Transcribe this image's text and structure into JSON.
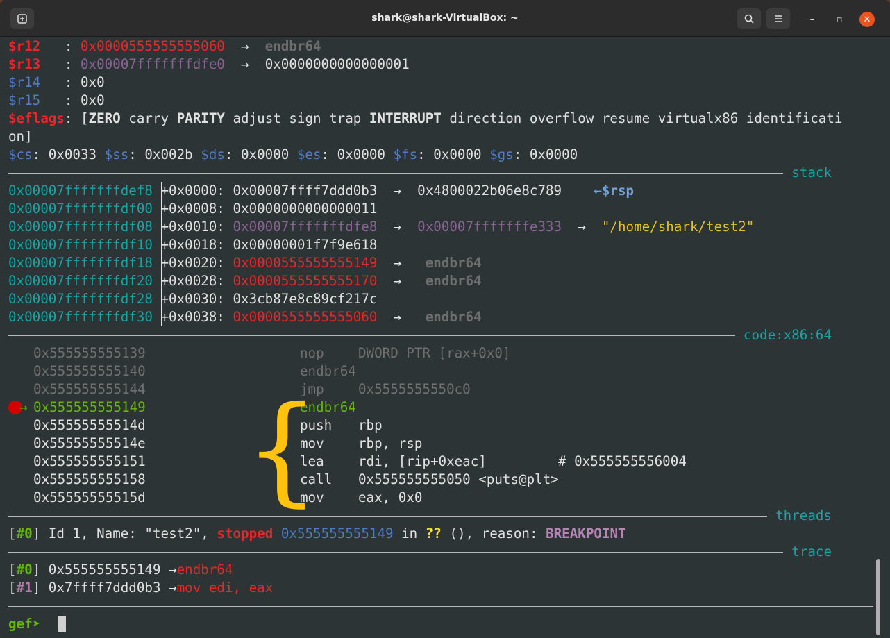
{
  "window": {
    "title": "shark@shark-VirtualBox: ~",
    "newtab_icon": "new-tab-icon",
    "search_icon": "search-icon",
    "menu_icon": "hamburger-menu-icon",
    "minimize_glyph": "–",
    "maximize_glyph": "▫",
    "close_glyph": "✕"
  },
  "registers": [
    {
      "name": "$r12",
      "colon": "   : ",
      "value": "0x0000555555555060",
      "arrow": "  →  ",
      "target": "endbr64"
    },
    {
      "name": "$r13",
      "colon": "   : ",
      "value": "0x00007fffffffdfe0",
      "arrow": "  →  ",
      "target": "0x0000000000000001"
    },
    {
      "name": "$r14",
      "colon": "   : ",
      "value": "0x0"
    },
    {
      "name": "$r15",
      "colon": "   : ",
      "value": "0x0"
    }
  ],
  "eflags": {
    "label": "$eflags",
    "line1_parts": [
      ": [",
      "ZERO",
      " carry ",
      "PARITY",
      " adjust sign trap ",
      "INTERRUPT",
      " direction overflow resume virtualx86 identificati"
    ],
    "line2": "on]"
  },
  "segments": [
    {
      "name": "$cs",
      "value": ": 0x0033 "
    },
    {
      "name": "$ss",
      "value": ": 0x002b "
    },
    {
      "name": "$ds",
      "value": ": 0x0000 "
    },
    {
      "name": "$es",
      "value": ": 0x0000 "
    },
    {
      "name": "$fs",
      "value": ": 0x0000 "
    },
    {
      "name": "$gs",
      "value": ": 0x0000"
    }
  ],
  "sections": {
    "stack": "stack",
    "code": "code:x86:64",
    "threads": "threads",
    "trace": "trace"
  },
  "stack": [
    {
      "addr": "0x00007fffffffdef8",
      "offset": "+0x0000: ",
      "value": "0x00007ffff7ddd0b3",
      "arrow": "  →  ",
      "target": "0x4800022b06e8c789",
      "extra": "    ←$rsp"
    },
    {
      "addr": "0x00007fffffffdf00",
      "offset": "+0x0008: ",
      "value": "0x0000000000000011"
    },
    {
      "addr": "0x00007fffffffdf08",
      "offset": "+0x0010: ",
      "value": "0x00007fffffffdfe8",
      "arrow": "  →  ",
      "target": "0x00007fffffffe333",
      "arrow2": "  →  ",
      "string": "\"/home/shark/test2\""
    },
    {
      "addr": "0x00007fffffffdf10",
      "offset": "+0x0018: ",
      "value": "0x00000001f7f9e618"
    },
    {
      "addr": "0x00007fffffffdf18",
      "offset": "+0x0020: ",
      "value": "0x0000555555555149",
      "arrow": "  →   ",
      "target": "endbr64"
    },
    {
      "addr": "0x00007fffffffdf20",
      "offset": "+0x0028: ",
      "value": "0x0000555555555170",
      "arrow": "  →   ",
      "target": "endbr64"
    },
    {
      "addr": "0x00007fffffffdf28",
      "offset": "+0x0030: ",
      "value": "0x3cb87e8c89cf217c"
    },
    {
      "addr": "0x00007fffffffdf30",
      "offset": "+0x0038: ",
      "value": "0x0000555555555060",
      "arrow": "  →   ",
      "target": "endbr64"
    }
  ],
  "code": [
    {
      "addr": "0x555555555139",
      "mnemonic": "nop",
      "operands": "DWORD PTR [rax+0x0]",
      "state": "past"
    },
    {
      "addr": "0x555555555140",
      "mnemonic": "endbr64",
      "operands": "",
      "state": "past"
    },
    {
      "addr": "0x555555555144",
      "mnemonic": "jmp",
      "operands": "0x5555555550c0",
      "state": "past"
    },
    {
      "addr": "0x555555555149",
      "mnemonic": "endbr64",
      "operands": "",
      "state": "current"
    },
    {
      "addr": "0x55555555514d",
      "mnemonic": "push",
      "operands": "rbp",
      "state": "next"
    },
    {
      "addr": "0x55555555514e",
      "mnemonic": "mov",
      "operands": "rbp, rsp",
      "state": "next"
    },
    {
      "addr": "0x555555555151",
      "mnemonic": "lea",
      "operands": "rdi, [rip+0xeac]",
      "comment": "# 0x555555556004",
      "state": "next"
    },
    {
      "addr": "0x555555555158",
      "mnemonic": "call",
      "operands": "0x555555555050 <puts@plt>",
      "state": "next"
    },
    {
      "addr": "0x55555555515d",
      "mnemonic": "mov",
      "operands": "eax, 0x0",
      "state": "next"
    }
  ],
  "code_marker": {
    "arrow": "→",
    "breakpoint": "breakpoint-dot"
  },
  "annotation": {
    "brace": "{"
  },
  "thread": {
    "idx": "#0",
    "info": " Id 1, Name: \"test2\", ",
    "status": "stopped",
    "addr": "0x555555555149",
    "in": " in ",
    "func": "??",
    "reason_label": " (), reason: ",
    "reason": "BREAKPOINT"
  },
  "trace": [
    {
      "idx": "#0",
      "addr": "0x555555555149",
      "arrow": " →",
      "insn": "endbr64"
    },
    {
      "idx": "#1",
      "addr": "0x7ffff7ddd0b3",
      "arrow": " →",
      "insn": "mov edi, eax"
    }
  ],
  "prompt": {
    "label": "gef",
    "chevron": "➤"
  },
  "colors": {
    "terminal_bg": "#2d3436",
    "register_red": "#e8272a",
    "register_blue": "#4f7cc6",
    "teal": "#16a5a5",
    "stack_string": "#e5c120",
    "current_line_green": "#64b70a",
    "brace_yellow": "#ffc20e",
    "breakpoint_red": "#d40000"
  }
}
